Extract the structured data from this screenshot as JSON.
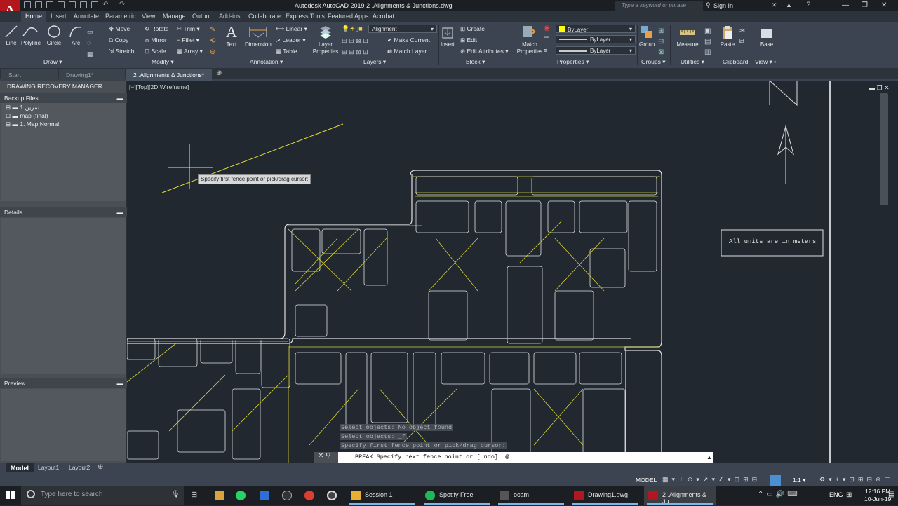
{
  "app": {
    "title": "Autodesk AutoCAD 2019    2 .Alignments & Junctions.dwg",
    "search_placeholder": "Type a keyword or phrase",
    "sign_in": "Sign In",
    "logo": "A"
  },
  "ribbon_tabs": [
    "Home",
    "Insert",
    "Annotate",
    "Parametric",
    "View",
    "Manage",
    "Output",
    "Add-ins",
    "Collaborate",
    "Express Tools",
    "Featured Apps",
    "Acrobat"
  ],
  "draw": {
    "line": "Line",
    "polyline": "Polyline",
    "circle": "Circle",
    "arc": "Arc",
    "panel": "Draw"
  },
  "modify": {
    "move": "Move",
    "rotate": "Rotate",
    "trim": "Trim",
    "copy": "Copy",
    "mirror": "Mirror",
    "fillet": "Fillet",
    "stretch": "Stretch",
    "scale": "Scale",
    "array": "Array",
    "panel": "Modify"
  },
  "annotation": {
    "text": "Text",
    "dimension": "Dimension",
    "linear": "Linear",
    "leader": "Leader",
    "table": "Table",
    "panel": "Annotation"
  },
  "layers": {
    "layer_properties": "Layer Properties",
    "current_layer": "Alignment",
    "make_current": "Make Current",
    "match_layer": "Match Layer",
    "panel": "Layers"
  },
  "block": {
    "insert": "Insert",
    "create": "Create",
    "edit": "Edit",
    "edit_attributes": "Edit Attributes",
    "panel": "Block"
  },
  "properties": {
    "match_properties": "Match Properties",
    "color": "ByLayer",
    "linetype": "ByLayer",
    "lineweight": "ByLayer",
    "panel": "Properties"
  },
  "groups": {
    "group": "Group",
    "panel": "Groups"
  },
  "utilities": {
    "measure": "Measure",
    "panel": "Utilities"
  },
  "clipboard": {
    "paste": "Paste",
    "panel": "Clipboard"
  },
  "view": {
    "base": "Base",
    "panel": "View"
  },
  "doc_tabs": [
    "Start",
    "Drawing1*",
    "2 .Alignments & Junctions*"
  ],
  "palette": {
    "title": "DRAWING RECOVERY MANAGER",
    "backup_header": "Backup Files",
    "files": [
      "تمرين 1",
      "map (final)",
      "1. Map Normal"
    ],
    "details_header": "Details",
    "preview_header": "Preview"
  },
  "viewport": {
    "label": "[−][Top][2D Wireframe]",
    "units_note": "All units are in meters",
    "tooltip": "Specify first fence point or pick/drag cursor:"
  },
  "command": {
    "history": [
      "Select objects: No object found",
      "Select objects: _f",
      "Specify first fence point or pick/drag cursor:"
    ],
    "current": "BREAK Specify next fence point or [Undo]: @"
  },
  "layout_tabs": [
    "Model",
    "Layout1",
    "Layout2"
  ],
  "status": {
    "model": "MODEL",
    "scale": "1:1"
  },
  "taskbar": {
    "search": "Type here to search",
    "apps": [
      "Session 1",
      "Spotify Free",
      "ocam",
      "Drawing1.dwg",
      "2 .Alignments & Ju..."
    ],
    "lang": "ENG",
    "time": "12:16 PM",
    "date": "10-Jun-19"
  }
}
